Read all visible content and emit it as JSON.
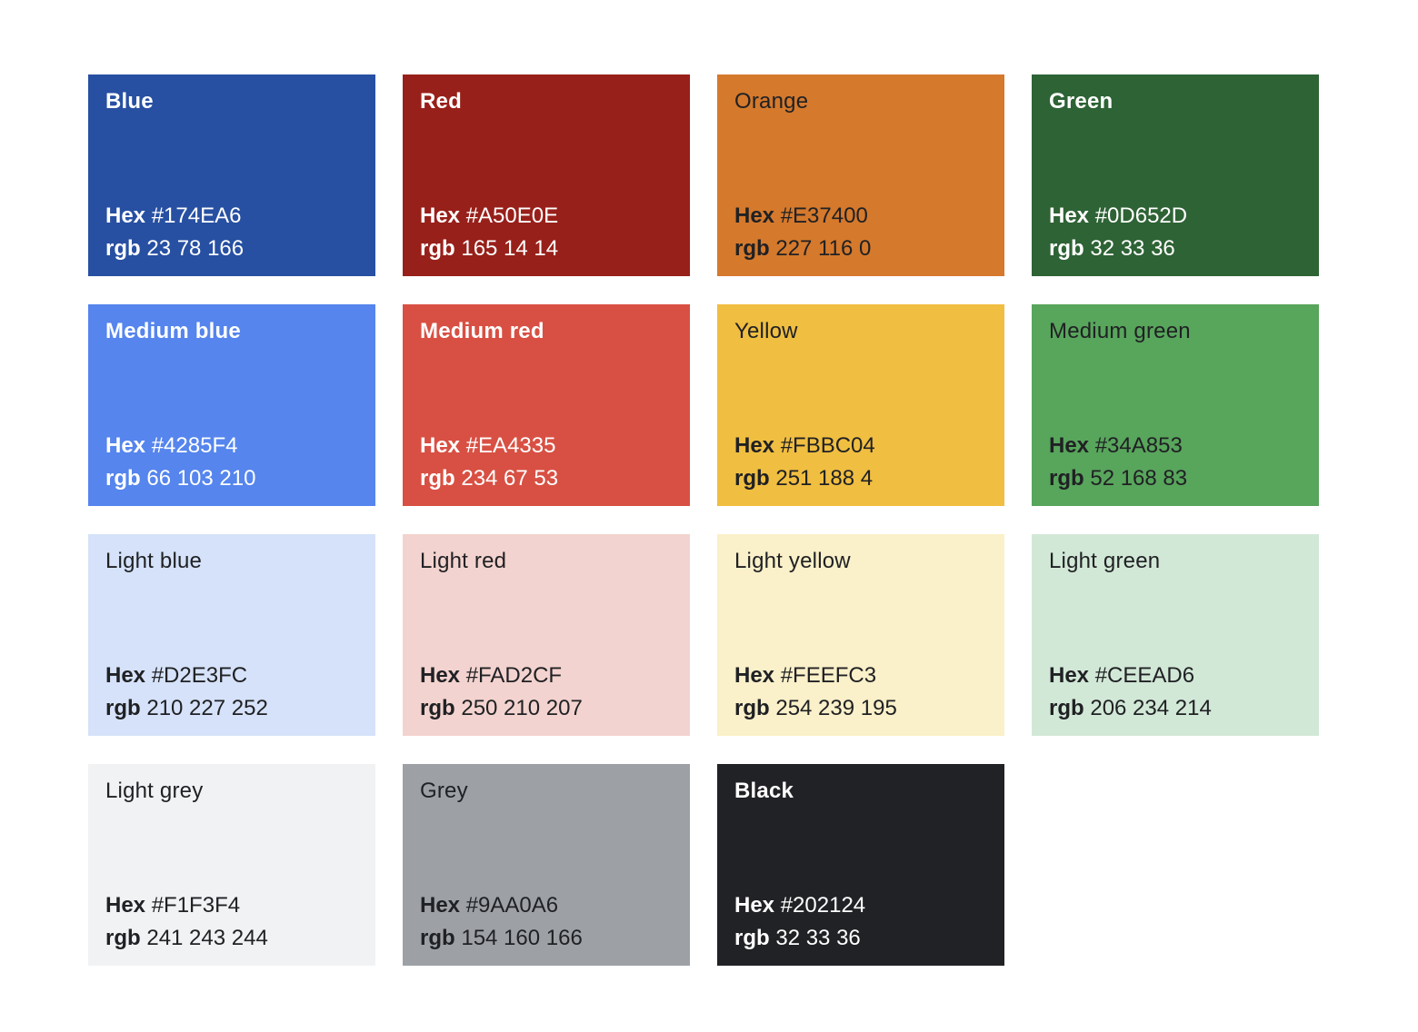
{
  "labels": {
    "hex": "Hex",
    "rgb": "rgb"
  },
  "swatches": [
    {
      "name": "Blue",
      "hex": "#174EA6",
      "rgb": "23 78 166",
      "fill": "#2750A2",
      "text": "light"
    },
    {
      "name": "Red",
      "hex": "#A50E0E",
      "rgb": "165 14 14",
      "fill": "#98201A",
      "text": "light"
    },
    {
      "name": "Orange",
      "hex": "#E37400",
      "rgb": "227 116 0",
      "fill": "#D5792C",
      "text": "dark"
    },
    {
      "name": "Green",
      "hex": "#0D652D",
      "rgb": "32 33 36",
      "fill": "#2E6335",
      "text": "light"
    },
    {
      "name": "Medium blue",
      "hex": "#4285F4",
      "rgb": "66 103 210",
      "fill": "#5585ED",
      "text": "light"
    },
    {
      "name": "Medium red",
      "hex": "#EA4335",
      "rgb": "234 67 53",
      "fill": "#D85043",
      "text": "light"
    },
    {
      "name": "Yellow",
      "hex": "#FBBC04",
      "rgb": "251 188 4",
      "fill": "#F0BE41",
      "text": "dark"
    },
    {
      "name": "Medium green",
      "hex": "#34A853",
      "rgb": "52 168 83",
      "fill": "#58A55C",
      "text": "dark"
    },
    {
      "name": "Light blue",
      "hex": "#D2E3FC",
      "rgb": "210 227 252",
      "fill": "#D5E2F9",
      "text": "dark"
    },
    {
      "name": "Light red",
      "hex": "#FAD2CF",
      "rgb": "250 210 207",
      "fill": "#F3D3CF",
      "text": "dark"
    },
    {
      "name": "Light yellow",
      "hex": "#FEEFC3",
      "rgb": "254 239 195",
      "fill": "#FAF0C9",
      "text": "dark"
    },
    {
      "name": "Light green",
      "hex": "#CEEAD6",
      "rgb": "206 234 214",
      "fill": "#D2E8D7",
      "text": "dark"
    },
    {
      "name": "Light grey",
      "hex": "#F1F3F4",
      "rgb": "241 243 244",
      "fill": "#F1F2F4",
      "text": "dark"
    },
    {
      "name": "Grey",
      "hex": "#9AA0A6",
      "rgb": "154 160 166",
      "fill": "#9DA1A5",
      "text": "dark"
    },
    {
      "name": "Black",
      "hex": "#202124",
      "rgb": "32 33 36",
      "fill": "#212225",
      "text": "light"
    }
  ]
}
